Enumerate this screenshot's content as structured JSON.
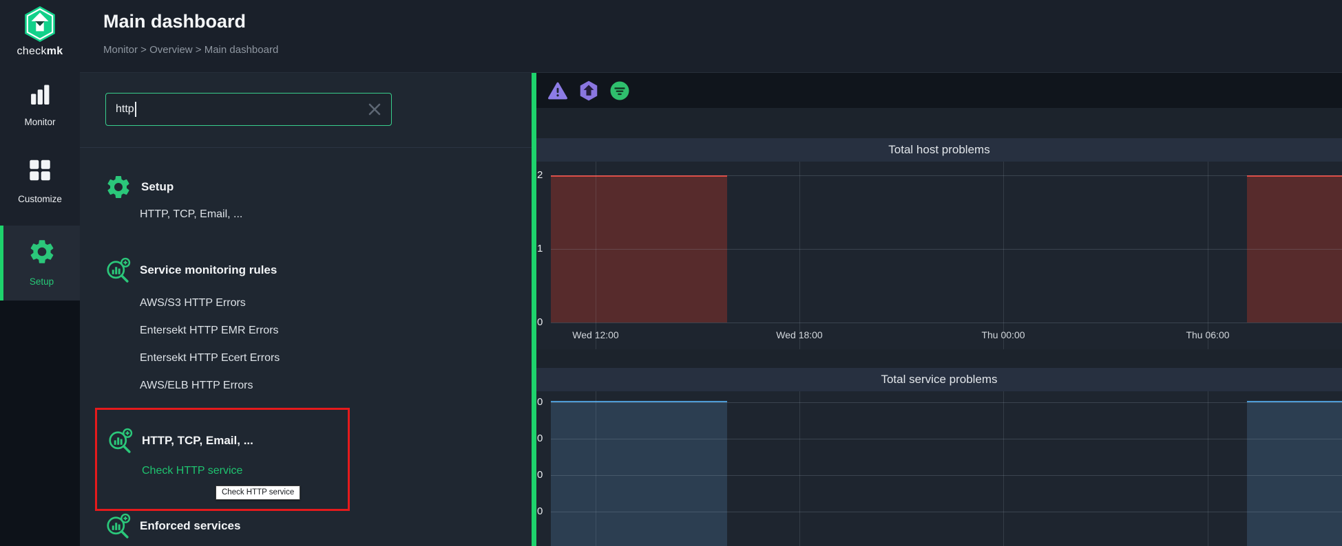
{
  "app": {
    "logo": {
      "icon": "checkmk-logo",
      "brand_regular": "check",
      "brand_bold": "mk"
    }
  },
  "sidebar": {
    "items": [
      {
        "icon": "bar-chart-icon",
        "label": "Monitor",
        "active": false
      },
      {
        "icon": "grid-icon",
        "label": "Customize",
        "active": false
      },
      {
        "icon": "gear-icon",
        "label": "Setup",
        "active": true
      }
    ]
  },
  "header": {
    "title": "Main dashboard",
    "breadcrumb": "Monitor > Overview > Main dashboard"
  },
  "search": {
    "value": "http",
    "clear_icon": "close-icon"
  },
  "results": {
    "groups": [
      {
        "icon": "gear-icon",
        "title": "Setup",
        "items": [
          "HTTP, TCP, Email, ..."
        ]
      },
      {
        "icon": "search-add-icon",
        "title": "Service monitoring rules",
        "items": [
          "AWS/S3 HTTP Errors",
          "Entersekt HTTP EMR Errors",
          "Entersekt HTTP Ecert Errors",
          "AWS/ELB HTTP Errors"
        ]
      },
      {
        "icon": "search-add-icon",
        "title": "HTTP, TCP, Email, ...",
        "highlighted_by_red_box": true,
        "items": [
          "Check HTTP service"
        ]
      },
      {
        "icon": "search-add-icon",
        "title": "Enforced services",
        "items": []
      }
    ],
    "tooltip": "Check HTTP service",
    "highlight_box_color": "#e51a1c"
  },
  "toolbar": {
    "icons": [
      "warning-icon",
      "checkmk-hexagon-icon",
      "filter-icon"
    ]
  },
  "chart_data": [
    {
      "type": "area",
      "title": "Total host problems",
      "yticks": [
        "2",
        "1",
        "0"
      ],
      "ylim": [
        0,
        2.2
      ],
      "grid": true,
      "legend": false,
      "xticks": [
        {
          "label": "Wed 12:00",
          "frac": 0.0566
        },
        {
          "label": "Wed 18:00",
          "frac": 0.3142
        },
        {
          "label": "Thu 00:00",
          "frac": 0.5718
        },
        {
          "label": "Thu 06:00",
          "frac": 0.8303
        }
      ],
      "series": [
        {
          "name": "host problems",
          "line_color": "#e2453c",
          "fill_color": "#572b2c",
          "segments": [
            {
              "from_frac": 0.0,
              "to_frac": 0.2228,
              "value": 2
            },
            {
              "from_frac": 0.2228,
              "to_frac": 0.88,
              "value": 0
            },
            {
              "from_frac": 0.88,
              "to_frac": 1.0,
              "value": 2
            }
          ]
        }
      ]
    },
    {
      "type": "area",
      "title": "Total service problems",
      "yticks": [
        "0",
        "0",
        "0",
        "0"
      ],
      "yticks_note": "labels truncated at left panel edge",
      "grid": true,
      "legend": false,
      "series": [
        {
          "name": "service problems",
          "line_color": "#4d9ad4",
          "fill_color": "#2c3e51",
          "segments": [
            {
              "from_frac": 0.0,
              "to_frac": 0.2228,
              "value": 1
            },
            {
              "from_frac": 0.2228,
              "to_frac": 0.88,
              "value": 0
            },
            {
              "from_frac": 0.88,
              "to_frac": 1.0,
              "value": 1
            }
          ]
        }
      ]
    }
  ]
}
